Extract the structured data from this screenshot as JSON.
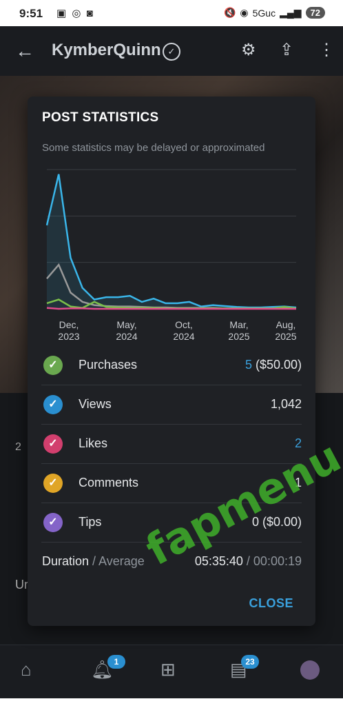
{
  "statusbar": {
    "time": "9:51",
    "network": "5Guc",
    "battery": "72"
  },
  "appbar": {
    "title": "KymberQuinn",
    "back_icon": "arrow-left-icon",
    "settings_icon": "gear-icon",
    "share_icon": "share-icon",
    "more_icon": "more-vertical-icon"
  },
  "background": {
    "count": "2",
    "text": "Ur"
  },
  "dialog": {
    "title": "POST STATISTICS",
    "subtitle": "Some statistics may be delayed or approximated",
    "rows": [
      {
        "label": "Purchases",
        "value_main": "5",
        "value_rest": " ($50.00)",
        "color": "#6aa84f"
      },
      {
        "label": "Views",
        "value_main": "",
        "value_rest": "1,042",
        "color": "#2a8fd0"
      },
      {
        "label": "Likes",
        "value_main": "2",
        "value_rest": "",
        "color": "#d23f6e"
      },
      {
        "label": "Comments",
        "value_main": "",
        "value_rest": "1",
        "color": "#e0a526"
      },
      {
        "label": "Tips",
        "value_main": "",
        "value_rest": "0 ($0.00)",
        "color": "#8464c8"
      }
    ],
    "duration_label": "Duration",
    "duration_sep": " / Average",
    "duration_value": "05:35:40",
    "duration_avg": " / 00:00:19",
    "close_label": "CLOSE"
  },
  "chart_data": {
    "type": "line",
    "x_tick_labels": [
      "Dec,\n2023",
      "May,\n2024",
      "Oct,\n2024",
      "Mar,\n2025",
      "Aug,\n2025"
    ],
    "grid": true,
    "series": [
      {
        "name": "Views",
        "color": "#3ab6ea",
        "values": [
          180,
          290,
          110,
          45,
          20,
          25,
          25,
          28,
          15,
          22,
          12,
          12,
          15,
          5,
          8,
          6,
          4,
          3,
          3,
          4,
          5,
          3
        ]
      },
      {
        "name": "Comments",
        "color": "#9a9a9a",
        "values": [
          65,
          95,
          35,
          15,
          8,
          6,
          5,
          5,
          4,
          3,
          3,
          2,
          2,
          2,
          2,
          1,
          1,
          1,
          1,
          1,
          1,
          1
        ]
      },
      {
        "name": "Purchases",
        "color": "#7cc04a",
        "values": [
          12,
          20,
          5,
          2,
          15,
          4,
          3,
          2,
          2,
          2,
          1,
          1,
          1,
          1,
          1,
          1,
          1,
          1,
          1,
          1,
          4,
          1
        ]
      },
      {
        "name": "Likes",
        "color": "#e04a8a",
        "values": [
          2,
          0,
          1,
          1,
          0,
          0,
          0,
          0,
          0,
          0,
          0,
          0,
          0,
          0,
          0,
          0,
          0,
          0,
          0,
          0,
          0,
          0
        ]
      }
    ],
    "ylim": [
      0,
      300
    ]
  },
  "bottomnav": {
    "notifications_badge": "1",
    "messages_badge": "23"
  },
  "watermark": "fapmenu.com"
}
